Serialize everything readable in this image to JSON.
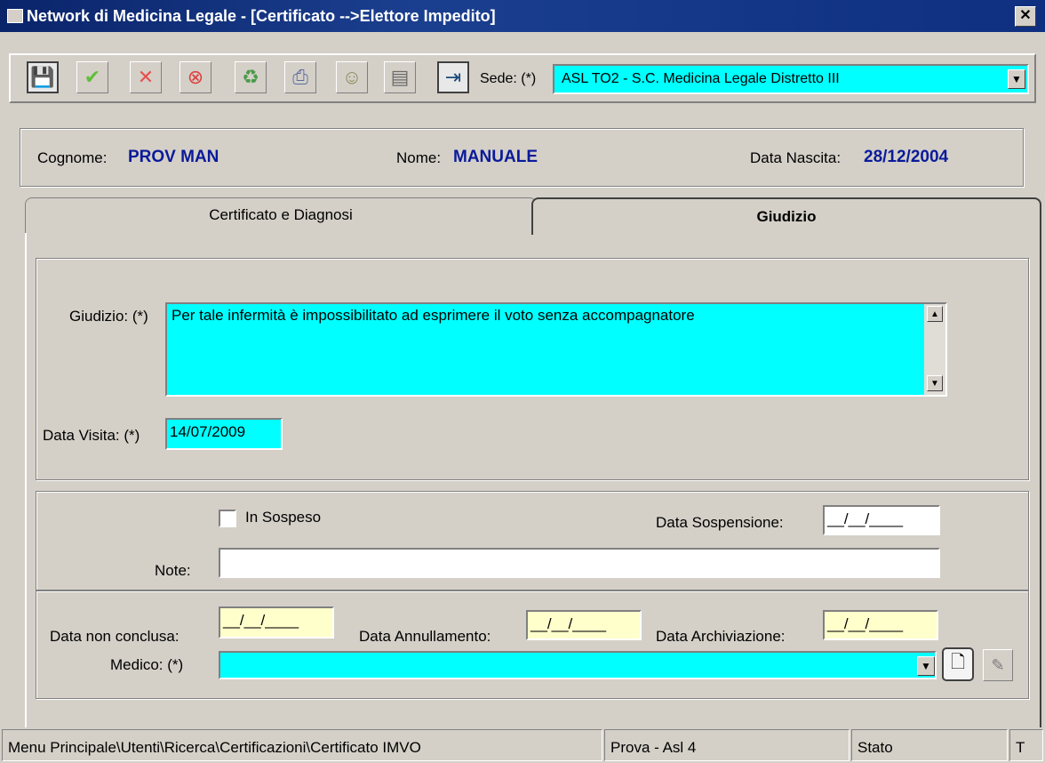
{
  "window": {
    "title": "Network di Medicina Legale - [Certificato -->Elettore Impedito]",
    "close_glyph": "✕"
  },
  "toolbar": {
    "buttons": [
      {
        "name": "save-button",
        "icon": "floppy-disk-icon",
        "glyph": "💾",
        "color": "#000000"
      },
      {
        "name": "confirm-button",
        "icon": "checkmark-icon",
        "glyph": "✔",
        "color": "#5fbf3a"
      },
      {
        "name": "cancel-button",
        "icon": "x-icon",
        "glyph": "✕",
        "color": "#e85050"
      },
      {
        "name": "delete-button",
        "icon": "stop-icon",
        "glyph": "⊗",
        "color": "#e04040"
      },
      {
        "name": "refresh-button",
        "icon": "refresh-icon",
        "glyph": "♻",
        "color": "#4a9a4a"
      },
      {
        "name": "print-button",
        "icon": "printer-icon",
        "glyph": "⎙",
        "color": "#5a6aa0"
      },
      {
        "name": "doctor-button",
        "icon": "person-icon",
        "glyph": "☺",
        "color": "#8a8a5a"
      },
      {
        "name": "document-button",
        "icon": "document-icon",
        "glyph": "▤",
        "color": "#6a6a6a"
      },
      {
        "name": "exit-button",
        "icon": "exit-door-icon",
        "glyph": "⇥",
        "color": "#1a4a7a"
      }
    ],
    "sede_label": "Sede: (*)",
    "sede_value": "ASL TO2 - S.C. Medicina Legale Distretto III"
  },
  "patient": {
    "cognome_label": "Cognome:",
    "cognome_value": "PROV MAN",
    "nome_label": "Nome:",
    "nome_value": "MANUALE",
    "nascita_label": "Data Nascita:",
    "nascita_value": "28/12/2004"
  },
  "tabs": [
    {
      "label": "Certificato e Diagnosi",
      "active": false
    },
    {
      "label": "Giudizio",
      "active": true
    }
  ],
  "giudizio": {
    "label": "Giudizio: (*)",
    "value": "Per tale infermità è impossibilitato ad esprimere il voto senza accompagnatore",
    "data_visita_label": "Data Visita: (*)",
    "data_visita_value": "14/07/2009"
  },
  "sospeso": {
    "checkbox_label": "In Sospeso",
    "checked": false,
    "data_sospensione_label": "Data Sospensione:",
    "data_sospensione_value": "__/__/____",
    "note_label": "Note:",
    "note_value": ""
  },
  "dates": {
    "non_conclusa_label": "Data non conclusa:",
    "non_conclusa_value": "__/__/____",
    "annullamento_label": "Data Annullamento:",
    "annullamento_value": "__/__/____",
    "archiviazione_label": "Data Archiviazione:",
    "archiviazione_value": "__/__/____",
    "medico_label": "Medico: (*)",
    "medico_value": ""
  },
  "statusbar": {
    "path": "Menu Principale\\Utenti\\Ricerca\\Certificazioni\\Certificato IMVO",
    "env": "Prova - Asl 4",
    "stato": "Stato",
    "t": "T"
  },
  "colors": {
    "title_bar": "#0a246a",
    "field_required": "#00ffff",
    "field_date": "#ffffcc",
    "header_value": "#0a1a9a"
  }
}
